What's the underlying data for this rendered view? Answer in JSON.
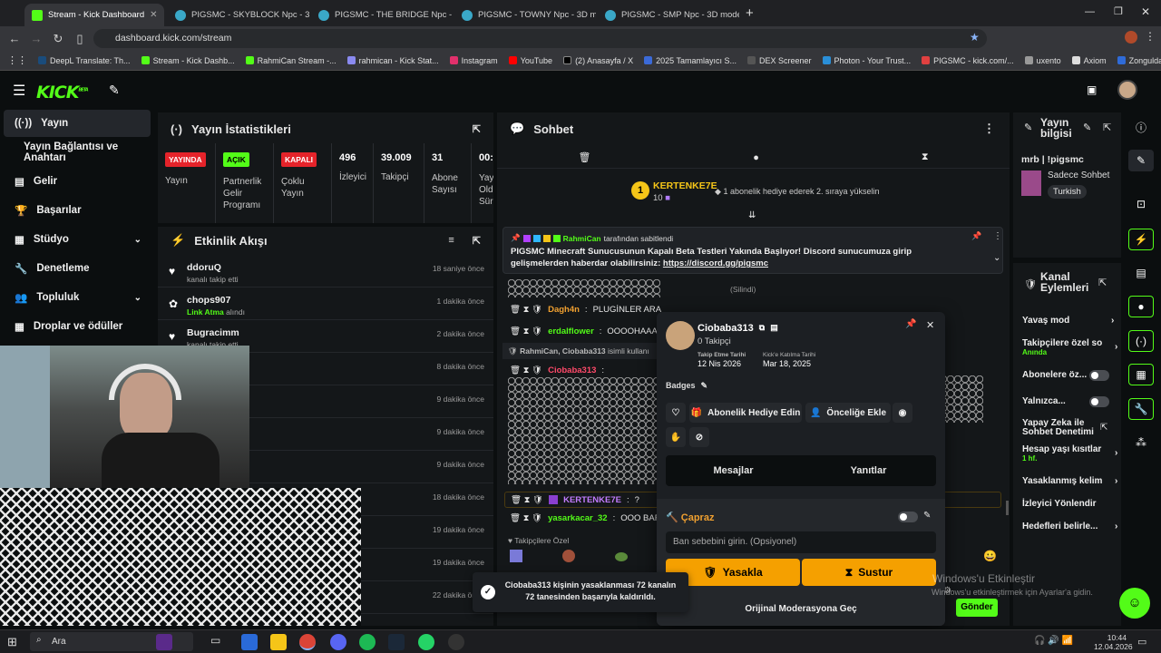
{
  "browser": {
    "tabs": [
      {
        "title": "Stream - Kick Dashboard",
        "active": true
      },
      {
        "title": "PIGSMC - SKYBLOCK Npc - 3D"
      },
      {
        "title": "PIGSMC - THE BRIDGE Npc - 3D"
      },
      {
        "title": "PIGSMC - TOWNY Npc - 3D mo"
      },
      {
        "title": "PIGSMC - SMP Npc - 3D mode"
      }
    ],
    "url": "dashboard.kick.com/stream",
    "bookmarks": [
      "DeepL Translate: Th...",
      "Stream - Kick Dashb...",
      "RahmiCan Stream -...",
      "rahmican - Kick Stat...",
      "Instagram",
      "YouTube",
      "(2) Anasayfa / X",
      "2025 Tamamlayıcı S...",
      "DEX Screener",
      "Photon - Your Trust...",
      "PIGSMC - kick.com/...",
      "uxento",
      "Axiom",
      "Zonguldak İngilizce..."
    ]
  },
  "app": {
    "logo": "KICK",
    "logo_beta": "BETA"
  },
  "sidebar": {
    "items": [
      {
        "label": "Yayın"
      },
      {
        "label": "Yayın Bağlantısı ve Anahtarı"
      },
      {
        "label": "Gelir"
      },
      {
        "label": "Başarılar"
      },
      {
        "label": "Stüdyo"
      },
      {
        "label": "Denetleme"
      },
      {
        "label": "Topluluk"
      },
      {
        "label": "Droplar ve ödüller"
      }
    ]
  },
  "stats": {
    "title": "Yayın İstatistikleri",
    "cells": [
      {
        "badge": "YAYINDA",
        "label": "Yayın",
        "color": "#e5232a"
      },
      {
        "badge": "AÇIK",
        "label": "Partnerlik Gelir Programı",
        "color": "#53fc18"
      },
      {
        "badge": "KAPALI",
        "label": "Çoklu Yayın",
        "color": "#e5232a"
      },
      {
        "value": "496",
        "label": "İzleyici"
      },
      {
        "value": "39.009",
        "label": "Takipçi"
      },
      {
        "value": "31",
        "label": "Abone Sayısı"
      },
      {
        "value": "00:",
        "label": "Yay Old Sür"
      }
    ]
  },
  "activity": {
    "title": "Etkinlik Akışı",
    "events": [
      {
        "name": "ddoruQ",
        "sub": "kanalı takip etti",
        "time": "18 saniye önce"
      },
      {
        "name": "chops907",
        "sub_hl": "Link Atma",
        "sub": "alındı",
        "time": "1 dakika önce"
      },
      {
        "name": "Bugracimm",
        "sub": "kanalı takip etti",
        "time": "2 dakika önce"
      },
      {
        "name": "",
        "sub": "",
        "time": "8 dakika önce"
      },
      {
        "name": "",
        "sub": "",
        "time": "9 dakika önce"
      },
      {
        "name": "",
        "sub": "",
        "time": "9 dakika önce"
      },
      {
        "name": "",
        "sub": "",
        "time": "9 dakika önce"
      },
      {
        "name": "",
        "sub": "",
        "time": "18 dakika önce"
      },
      {
        "name": "",
        "sub": "",
        "time": "19 dakika önce"
      },
      {
        "name": "",
        "sub": "",
        "time": "19 dakika önce"
      },
      {
        "name": "",
        "sub": "",
        "time": "22 dakika önce"
      }
    ]
  },
  "chat": {
    "title": "Sohbet",
    "top_gifter": {
      "name": "KERTENKE7E",
      "count": "10",
      "message": "1 abonelik hediye ederek 2. sıraya yükselin"
    },
    "pinned": {
      "by": "RahmiCan",
      "by_suffix": "tarafından sabitlendi",
      "text": "PIGSMC Minecraft Sunucusunun Kapalı Beta Testleri Yakında Başlıyor! Discord sunucumuza girip gelişmelerden haberdar olabilirsiniz:",
      "link": "https://discord.gg/pigsmc"
    },
    "deleted": "(Silindi)",
    "lines": [
      {
        "user": "Dagh4n",
        "text": "PLUGİNLER ARA",
        "color": "#f0a030"
      },
      {
        "user": "erdalflower",
        "text": "OOOOHAAA",
        "color": "#53fc18"
      },
      {
        "user": "RahmiCan, Ciobaba313",
        "text": "isimli kullanı",
        "system": true
      },
      {
        "user": "Ciobaba313",
        "text": "",
        "color": "#ff4a6a"
      },
      {
        "user": "KERTENKE7E",
        "text": "?",
        "color": "#c27cff"
      },
      {
        "user": "yasarkacar_32",
        "text": "OOO BAF",
        "color": "#53fc18"
      }
    ],
    "followers_only_label": "Takipçilere Özel",
    "send_button": "Gönder"
  },
  "user_card": {
    "username": "Ciobaba313",
    "followers": "0 Takipçi",
    "follow_date_label": "Takip Etme Tarihi",
    "follow_date": "12 Nis 2026",
    "join_date_label": "Kick'e Katılma Tarihi",
    "join_date": "Mar 18, 2025",
    "badges_label": "Badges",
    "gift_sub": "Abonelik Hediye Edin",
    "vip": "Önceliğe Ekle",
    "tab_messages": "Mesajlar",
    "tab_replies": "Yanıtlar",
    "rule_title": "Çapraz",
    "ban_reason_placeholder": "Ban sebebini girin. (Opsiyonel)",
    "ban_button": "Yasakla",
    "timeout_button": "Sustur",
    "original_mod": "Orijinal Moderasyona Geç"
  },
  "toast": {
    "text": "Ciobaba313 kişinin yasaklanması 72 kanalın 72 tanesinden başarıyla kaldırıldı."
  },
  "stream_info": {
    "title": "Yayın bilgisi",
    "stream_title": "mrb | !pigsmc",
    "category": "Sadece Sohbet",
    "language": "Turkish"
  },
  "channel_actions": {
    "title": "Kanal Eylemleri",
    "items": [
      {
        "label": "Yavaş mod",
        "type": "chevron"
      },
      {
        "label": "Takipçilere özel so",
        "sub": "Anında",
        "type": "chevron"
      },
      {
        "label": "Abonelere öz...",
        "type": "toggle"
      },
      {
        "label": "Yalnızca...",
        "type": "toggle"
      },
      {
        "label": "Yapay Zeka ile Sohbet Denetimi",
        "type": "external"
      },
      {
        "label": "Hesap yaşı kısıtlar",
        "sub": "1 hf.",
        "type": "chevron"
      },
      {
        "label": "Yasaklanmış kelim",
        "type": "chevron"
      },
      {
        "label": "İzleyici Yönlendir",
        "type": "none"
      },
      {
        "label": "Hedefleri belirle...",
        "type": "chevron"
      }
    ]
  },
  "watermark": {
    "line1": "Windows'u Etkinleştir",
    "line2": "Windows'u etkinleştirmek için Ayarlar'a gidin."
  },
  "taskbar": {
    "search": "Ara",
    "time": "10:44",
    "date": "12.04.2026"
  }
}
